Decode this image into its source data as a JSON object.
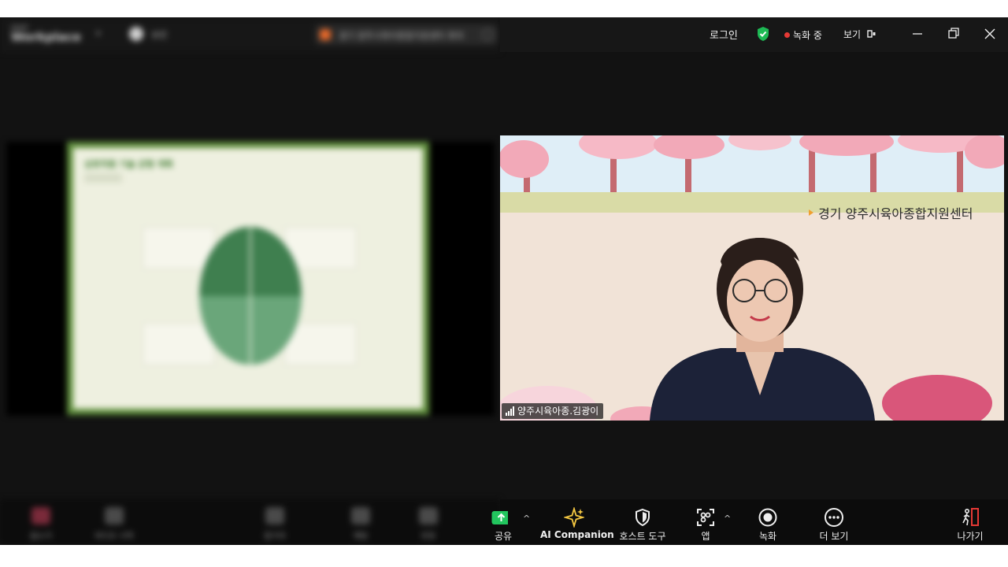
{
  "titlebar": {
    "brand_small": "zoom",
    "brand_big": "Workplace",
    "security_label": "보안",
    "meeting_title": "경기 양주시육아종합지원센터 회의",
    "login_label": "로그인",
    "recording_label": "녹화 중",
    "view_label": "보기"
  },
  "shared_screen": {
    "slide_title": "상호작용 기술 균형 계획"
  },
  "video": {
    "banner_text": "경기 양주시육아종합지원센터",
    "participant_name": "양주시육아종.김광이"
  },
  "toolbar": {
    "blurred_items": [
      "음소거",
      "비디오 시작",
      "참가자",
      "채팅",
      "반응"
    ],
    "share_label": "공유",
    "ai_label": "AI Companion",
    "host_tools_label": "호스트 도구",
    "apps_label": "앱",
    "record_label": "녹화",
    "more_label": "더 보기",
    "leave_label": "나가기"
  },
  "colors": {
    "app_bg": "#121212",
    "toolbar_bg": "#0c0c0c",
    "share_green": "#22c55e",
    "ai_accent": "#f5c842",
    "leave_red": "#e53935",
    "shield_green": "#1db954"
  }
}
